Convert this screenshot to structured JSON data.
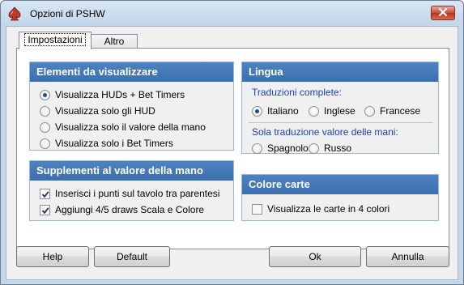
{
  "window": {
    "title": "Opzioni di PSHW"
  },
  "tabs": [
    {
      "label": "Impostazioni",
      "active": true
    },
    {
      "label": "Altro",
      "active": false
    }
  ],
  "elements_group": {
    "title": "Elementi da visualizzare",
    "options": [
      {
        "label": "Visualizza HUDs + Bet Timers",
        "selected": true
      },
      {
        "label": "Visualizza solo gli HUD",
        "selected": false
      },
      {
        "label": "Visualizza solo il valore della mano",
        "selected": false
      },
      {
        "label": "Visualizza solo i Bet Timers",
        "selected": false
      }
    ]
  },
  "supplements_group": {
    "title": "Supplementi al valore della mano",
    "options": [
      {
        "label": "Inserisci i punti sul tavolo tra parentesi",
        "checked": true
      },
      {
        "label": "Aggiungi 4/5 draws Scala e Colore",
        "checked": true
      }
    ]
  },
  "language_group": {
    "title": "Lingua",
    "full_heading": "Traduzioni complete:",
    "full_options": [
      {
        "label": "Italiano",
        "selected": true
      },
      {
        "label": "Inglese",
        "selected": false
      },
      {
        "label": "Francese",
        "selected": false
      }
    ],
    "partial_heading": "Sola traduzione valore delle mani:",
    "partial_options": [
      {
        "label": "Spagnolo",
        "selected": false
      },
      {
        "label": "Russo",
        "selected": false
      }
    ]
  },
  "card_color_group": {
    "title": "Colore carte",
    "options": [
      {
        "label": "Visualizza le carte in 4 colori",
        "checked": false
      }
    ]
  },
  "buttons": {
    "help": "Help",
    "default": "Default",
    "ok": "Ok",
    "cancel": "Annulla"
  },
  "colors": {
    "group_header": "#3b6fb0",
    "sub_heading": "#1a3fb8",
    "close_button": "#c8493a"
  },
  "icons": {
    "app": "spade-icon",
    "close": "close-icon"
  }
}
